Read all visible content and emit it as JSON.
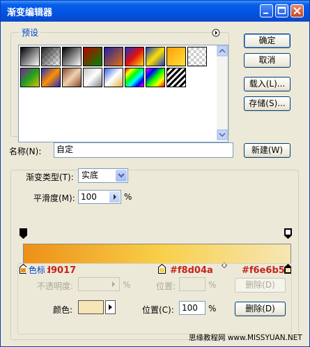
{
  "window": {
    "title": "渐变编辑器"
  },
  "presets_label": "预设",
  "buttons": {
    "ok": "确定",
    "cancel": "取消",
    "load": "载入(L)...",
    "save": "存储(S)...",
    "new": "新建(W)",
    "delete_opacity": "删除(D)",
    "delete_color": "删除(D)"
  },
  "name": {
    "label": "名称(N):",
    "value": "自定"
  },
  "gradient_type": {
    "label": "渐变类型(T):",
    "value": "实底"
  },
  "smoothness": {
    "label": "平滑度(M):",
    "value": "100",
    "unit": "%"
  },
  "stops": {
    "left_hex": "#ed9017",
    "mid_hex": "#f8d04a",
    "right_hex": "#f6e6b5"
  },
  "colors": {
    "c1": "#ed9017",
    "c2": "#f8d04a",
    "c3": "#f6e6b5"
  },
  "color_stops_group": {
    "label": "色标",
    "opacity_label": "不透明度:",
    "opacity_unit": "%",
    "position_label": "位置:",
    "position_unit": "%",
    "color_label": "颜色:",
    "color_position_label": "位置(C):",
    "color_position_value": "100",
    "color_position_unit": "%"
  },
  "watermark": "思缘教程网 www.MISSYUAN.NET"
}
